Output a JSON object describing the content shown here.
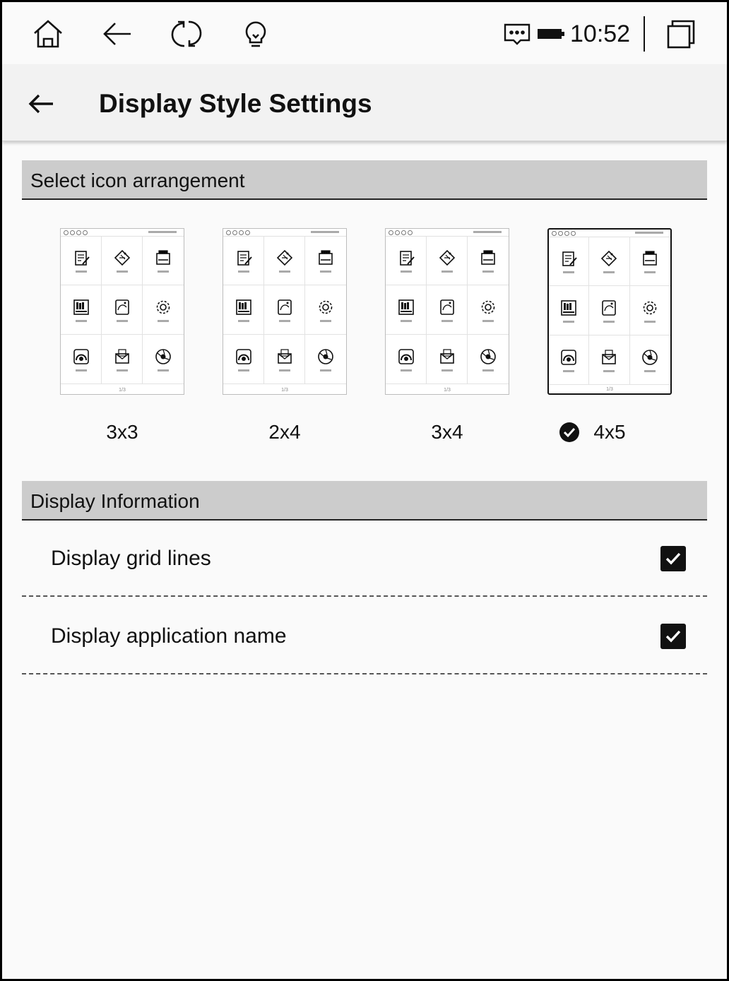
{
  "statusbar": {
    "icons": [
      "home-icon",
      "back-arrow-icon",
      "refresh-icon",
      "lightbulb-icon",
      "message-icon",
      "battery-icon",
      "recent-apps-icon"
    ],
    "time": "10:52"
  },
  "appbar": {
    "title": "Display Style Settings",
    "back_icon": "back-arrow-icon"
  },
  "arrangement": {
    "header": "Select icon arrangement",
    "options": [
      {
        "label": "3x3",
        "selected": false
      },
      {
        "label": "2x4",
        "selected": false
      },
      {
        "label": "3x4",
        "selected": false
      },
      {
        "label": "4x5",
        "selected": true
      }
    ],
    "preview_page": "1/3",
    "preview_icons": [
      "notebook-icon",
      "tag-icon",
      "file-manager-icon",
      "bookshelf-icon",
      "gallery-icon",
      "settings-icon",
      "handwriting-icon",
      "mail-icon",
      "browser-icon"
    ]
  },
  "display_info": {
    "header": "Display Information",
    "items": [
      {
        "label": "Display grid lines",
        "checked": true
      },
      {
        "label": "Display application name",
        "checked": true
      }
    ]
  },
  "colors": {
    "accent": "#111111",
    "header_bg": "#cccccc",
    "background": "#fafafa"
  }
}
